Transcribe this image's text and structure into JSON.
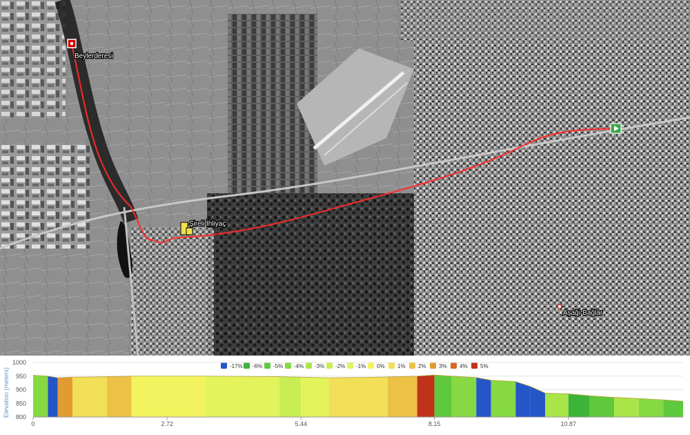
{
  "map": {
    "places": [
      {
        "id": "start",
        "label": "Beylerderesi"
      },
      {
        "id": "poi",
        "label": "Şireli İhliyaç"
      },
      {
        "id": "aux",
        "label": "Aşağı Bağlar"
      }
    ]
  },
  "elevation": {
    "legend": [
      {
        "label": "-17%",
        "color": "#2456c8"
      },
      {
        "label": "-6%",
        "color": "#3db33a"
      },
      {
        "label": "-5%",
        "color": "#5ec93c"
      },
      {
        "label": "-4%",
        "color": "#86d943"
      },
      {
        "label": "-3%",
        "color": "#a9e548"
      },
      {
        "label": "-2%",
        "color": "#c8ee54"
      },
      {
        "label": "-1%",
        "color": "#e2f35c"
      },
      {
        "label": "0%",
        "color": "#f3f360"
      },
      {
        "label": "1%",
        "color": "#f2df58"
      },
      {
        "label": "2%",
        "color": "#ecc146"
      },
      {
        "label": "3%",
        "color": "#e29a32"
      },
      {
        "label": "4%",
        "color": "#d46a22"
      },
      {
        "label": "5%",
        "color": "#c0321a"
      }
    ],
    "y_ticks": [
      "1000",
      "950",
      "900",
      "850",
      "800"
    ],
    "x_ticks": [
      "0",
      "2.72",
      "5.44",
      "8.15",
      "10.87"
    ],
    "ylabel": "Elevation (meters)"
  },
  "chart_data": {
    "type": "area",
    "ylabel": "Elevation (meters)",
    "ylim": [
      800,
      1000
    ],
    "xlim": [
      0,
      13.2
    ],
    "x": [
      0,
      0.3,
      0.5,
      0.8,
      1.5,
      2.0,
      2.72,
      3.5,
      4.2,
      5.0,
      5.44,
      6.0,
      6.6,
      7.2,
      7.8,
      8.15,
      8.5,
      9.0,
      9.3,
      9.8,
      10.1,
      10.4,
      10.87,
      11.3,
      11.8,
      12.3,
      12.8,
      13.2
    ],
    "y": [
      953,
      950,
      944,
      946,
      948,
      950,
      950,
      950,
      949,
      948,
      946,
      944,
      945,
      947,
      950,
      954,
      950,
      945,
      935,
      930,
      912,
      888,
      885,
      878,
      872,
      868,
      863,
      858
    ]
  }
}
